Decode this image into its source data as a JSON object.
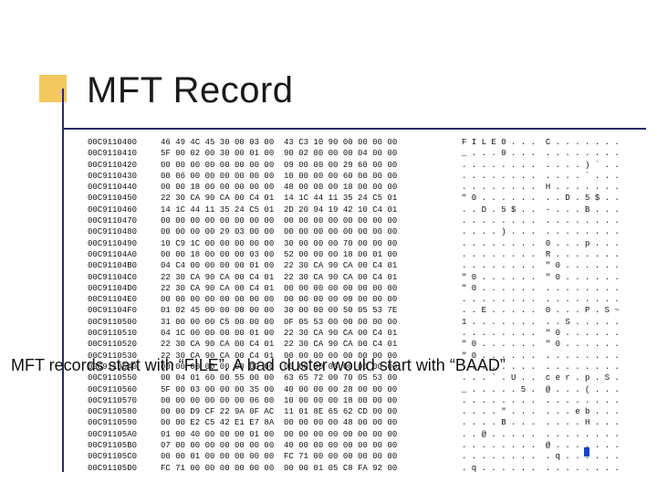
{
  "colors": {
    "accent": "#f2c85f",
    "rule": "#2a2a6a",
    "caret": "#1b45c4"
  },
  "title": "MFT Record",
  "caption": "MFT records start with “FILE”.  A bad cluster would start with “BAAD”",
  "hex": {
    "offsets": [
      "00C9110400",
      "00C9110410",
      "00C9110420",
      "00C9110430",
      "00C9110440",
      "00C9110450",
      "00C9110460",
      "00C9110470",
      "00C9110480",
      "00C9110490",
      "00C91104A0",
      "00C91104B0",
      "00C91104C0",
      "00C91104D0",
      "00C91104E0",
      "00C91104F0",
      "00C9110500",
      "00C9110510",
      "00C9110520",
      "00C9110530",
      "00C9110540",
      "00C9110550",
      "00C9110560",
      "00C9110570",
      "00C9110580",
      "00C9110590",
      "00C91105A0",
      "00C91105B0",
      "00C91105C0",
      "00C91105D0"
    ],
    "hexcols": [
      "46 49 4C 45 30 00 03 00  43 C3 10 90 00 00 00 00",
      "5F 00 02 00 30 00 01 00  90 02 00 00 00 04 00 00",
      "00 00 00 00 00 00 00 00  09 00 00 00 29 60 00 00",
      "00 06 00 00 00 00 00 00  10 00 00 00 60 00 00 00",
      "00 00 18 00 00 00 00 00  48 00 00 00 18 00 00 00",
      "22 30 CA 90 CA 00 C4 01  14 1C 44 11 35 24 C5 01",
      "14 1C 44 11 35 24 C5 01  2D 20 94 19 42 10 C4 01",
      "00 00 00 00 00 00 00 00  00 00 00 00 00 00 00 00",
      "00 00 00 00 29 03 00 00  00 00 00 00 00 00 00 00",
      "10 C9 1C 00 00 00 00 00  30 00 00 00 70 00 00 00",
      "00 00 18 00 00 00 03 00  52 00 00 00 18 00 01 00",
      "04 C4 00 00 00 00 01 00  22 30 CA 90 CA 00 C4 01",
      "22 30 CA 90 CA 00 C4 01  22 30 CA 90 CA 00 C4 01",
      "22 30 CA 90 CA 00 C4 01  00 00 00 00 00 00 00 00",
      "00 00 00 00 00 00 00 00  00 00 00 00 00 00 00 00",
      "01 02 45 00 00 00 00 00  30 00 00 00 50 05 53 7E",
      "31 00 00 00 C5 00 00 00  0F 05 53 00 00 00 00 00",
      "04 1C 00 00 00 00 01 00  22 30 CA 90 CA 00 C4 01",
      "22 30 CA 90 CA 00 C4 01  22 30 CA 90 CA 00 C4 01",
      "22 30 CA 90 CA 00 C4 01  00 00 00 00 00 00 00 00",
      "00 00 00 00 00 00 00 00  00 00 00 00 00 00 00 00",
      "00 04 01 60 00 55 00 00  63 65 72 00 70 05 53 00",
      "5F 00 03 00 00 00 35 00  40 00 00 00 28 00 00 00",
      "00 00 00 00 00 00 06 00  10 00 00 00 18 00 00 00",
      "00 00 D9 CF 22 9A 0F AC  11 01 8E 65 62 CD 00 00",
      "00 00 E2 C5 42 E1 E7 8A  00 00 00 00 48 00 00 00",
      "01 00 40 00 00 00 01 00  00 00 00 00 00 00 00 00",
      "07 00 00 00 00 00 00 00  40 00 00 00 00 00 00 00",
      "00 00 01 00 00 00 00 00  FC 71 00 00 00 00 00 00",
      "FC 71 00 00 00 00 00 00  00 00 01 05 C8 FA 92 00"
    ],
    "asccols": [
      "F I L E 0 . . .  C . . . . . . .",
      "_ . . . 0 . . .  . . . . . . . .",
      ". . . . . . . .  . . . . ) ` . .",
      ". . . . . . . .  . . . . ` . . .",
      ". . . . . . . .  H . . . . . . .",
      "\" 0 . . . . . .  . . D . 5 $ . .",
      ". . D . 5 $ . .  - . . . B . . .",
      ". . . . . . . .  . . . . . . . .",
      ". . . . ) . . .  . . . . . . . .",
      ". . . . . . . .  0 . . . p . . .",
      ". . . . . . . .  R . . . . . . .",
      ". . . . . . . .  \" 0 . . . . . .",
      "\" 0 . . . . . .  \" 0 . . . . . .",
      "\" 0 . . . . . .  . . . . . . . .",
      ". . . . . . . .  . . . . . . . .",
      ". . E . . . . .  0 . . . P . S ~",
      "1 . . . . . . .  . . S . . . . .",
      ". . . . . . . .  \" 0 . . . . . .",
      "\" 0 . . . . . .  \" 0 . . . . . .",
      "\" 0 . . . . . .  . . . . . . . .",
      ". . . . . . . .  . . . . . . . .",
      ". . . ` . U . .  c e r . p . S .",
      "_ . . . . . 5 .  @ . . . ( . . .",
      ". . . . . . . .  . . . . . . . .",
      ". . . . \" . . .  . . . e b . . .",
      ". . . . B . . .  . . . . H . . .",
      ". . @ . . . . .  . . . . . . . .",
      ". . . . . . . .  @ . . . . . . .",
      ". . . . . . . .  . q . . . . . .",
      ". q . . . . . .  . . . . . . . ."
    ]
  }
}
